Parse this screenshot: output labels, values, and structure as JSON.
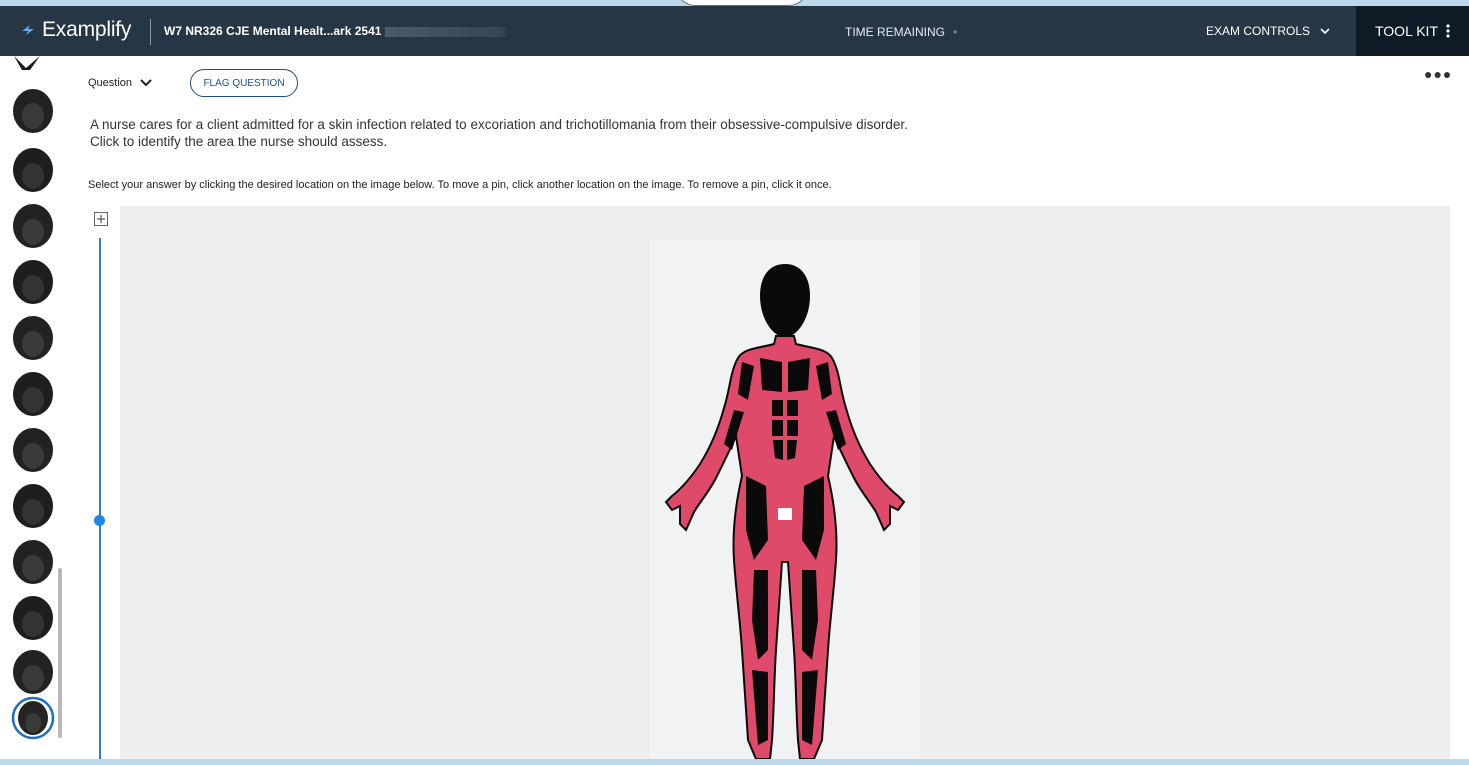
{
  "app": {
    "logo_text": "Examplify",
    "exam_title": "W7 NR326 CJE Mental Healt...ark 2541"
  },
  "header": {
    "time_label": "TIME REMAINING",
    "exam_controls_label": "EXAM CONTROLS",
    "toolkit_label": "TOOL KIT"
  },
  "question": {
    "label": "Question",
    "flag_label": "FLAG QUESTION",
    "stem_line1": "A nurse cares for a client admitted for a skin infection related to excoriation and trichotillomania from their obsessive-compulsive disorder.",
    "stem_line2": "Click to identify the area the nurse should assess.",
    "instructions": "Select your answer by clicking the desired location on the image below. To move a pin, click another location on the image. To remove a pin, click it once."
  },
  "icons": {
    "logo": "examplify-logo-icon",
    "controls": "chevron-down-icon",
    "toolkit": "kebab-menu-icon",
    "question_nav": "chevron-down-icon",
    "more": "more-horizontal-icon",
    "zoom": "zoom-in-icon"
  },
  "colors": {
    "header_bg": "#263645",
    "toolkit_bg": "#0e1a26",
    "accent_blue": "#1f86e8",
    "flag_border": "#1c4f80",
    "muscle_red": "#e04a6a",
    "body_black": "#0a0a0a"
  }
}
